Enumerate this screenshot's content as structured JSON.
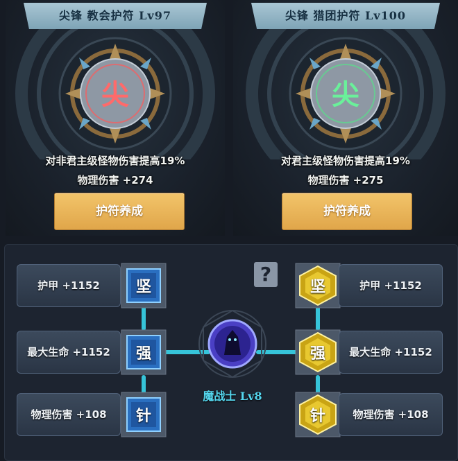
{
  "amulets": [
    {
      "title": "尖锋 教会护符 Lv97",
      "glyph": "尖",
      "glow_color": "#ff5a5a",
      "stat_line_1": "对非君主级怪物伤害提高19%",
      "stat_line_2": "物理伤害 +274",
      "button_label": "护符养成"
    },
    {
      "title": "尖锋 猎团护符 Lv100",
      "glyph": "尖",
      "glow_color": "#59e08a",
      "stat_line_1": "对君主级怪物伤害提高19%",
      "stat_line_2": "物理伤害 +275",
      "button_label": "护符养成"
    }
  ],
  "help_icon": "?",
  "center": {
    "class_label": "魔战士 Lv8",
    "icon": "warrior-portrait-icon"
  },
  "left_bonuses": [
    {
      "stat": "护甲 +1152",
      "gem": "坚",
      "gem_style": "blue-square"
    },
    {
      "stat": "最大生命 +1152",
      "gem": "强",
      "gem_style": "blue-square"
    },
    {
      "stat": "物理伤害 +108",
      "gem": "针",
      "gem_style": "blue-square"
    }
  ],
  "right_bonuses": [
    {
      "stat": "护甲 +1152",
      "gem": "坚",
      "gem_style": "gold-hexagon"
    },
    {
      "stat": "最大生命 +1152",
      "gem": "强",
      "gem_style": "gold-hexagon"
    },
    {
      "stat": "物理伤害 +108",
      "gem": "针",
      "gem_style": "gold-hexagon"
    }
  ],
  "colors": {
    "connector": "#39d6ec",
    "button": "#e8b458",
    "banner": "#94b6c6"
  }
}
